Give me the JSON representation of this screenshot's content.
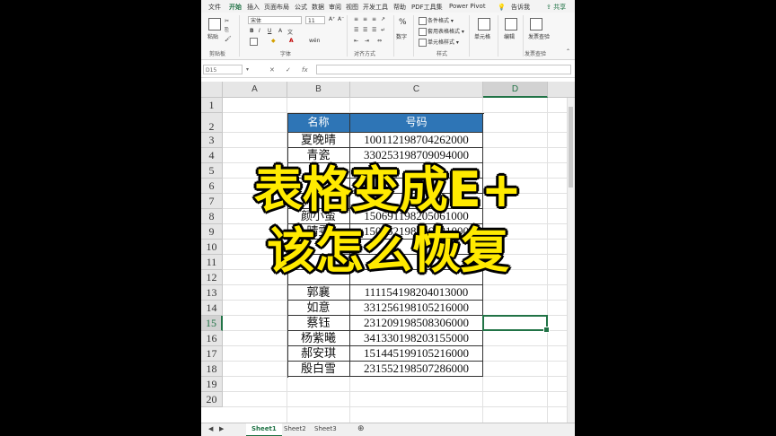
{
  "ribbon": {
    "tabs": [
      "文件",
      "开始",
      "插入",
      "页面布局",
      "公式",
      "数据",
      "审阅",
      "视图",
      "开发工具",
      "帮助",
      "PDF工具集",
      "Power Pivot"
    ],
    "active_tab": "开始",
    "tell_me": "告诉我",
    "share": "共享",
    "paste_label": "粘贴",
    "clipboard_group": "剪贴板",
    "font_name": "宋体",
    "font_size": "11",
    "font_group": "字体",
    "align_group": "对齐方式",
    "number_label": "数字",
    "cond_format": "条件格式",
    "table_format": "套用表格格式",
    "cell_style": "单元格样式",
    "styles_group": "样式",
    "cells_label": "单元格",
    "edit_label": "编辑",
    "invoice_check": "发票查验",
    "invoice_group": "发票查验"
  },
  "formula_bar": {
    "name_box": "D15",
    "fx": "fx"
  },
  "grid": {
    "columns": [
      "A",
      "B",
      "C",
      "D"
    ],
    "rows": [
      "1",
      "2",
      "3",
      "4",
      "5",
      "6",
      "7",
      "8",
      "9",
      "10",
      "11",
      "12",
      "13",
      "14",
      "15",
      "16",
      "17",
      "18",
      "19",
      "20"
    ],
    "selected_column": "D",
    "selected_row": "15"
  },
  "table": {
    "headers": [
      "名称",
      "号码"
    ],
    "rows": [
      [
        "夏晚晴",
        "100112198704262000"
      ],
      [
        "青瓷",
        "330253198709094000"
      ],
      [
        "",
        ""
      ],
      [
        "",
        ""
      ],
      [
        "",
        ""
      ],
      [
        "颜小蛮",
        "150691198205061000"
      ],
      [
        "晴雯",
        "150752198406081000"
      ],
      [
        "",
        ""
      ],
      [
        "",
        ""
      ],
      [
        "",
        ""
      ],
      [
        "郭襄",
        "111154198204013000"
      ],
      [
        "如意",
        "331256198105216000"
      ],
      [
        "蔡钰",
        "231209198508306000"
      ],
      [
        "杨紫曦",
        "341330198203155000"
      ],
      [
        "郝安琪",
        "151445199105216000"
      ],
      [
        "殷白雪",
        "231552198507286000"
      ]
    ]
  },
  "sheets": [
    "Sheet1",
    "Sheet2",
    "Sheet3"
  ],
  "active_sheet": "Sheet1",
  "add_sheet": "⊕",
  "overlay": {
    "line1": "表格变成E+",
    "line2": "该怎么恢复"
  },
  "colors": {
    "accent": "#217346",
    "header_fill": "#2e75b6",
    "overlay_text": "#ffea00"
  }
}
